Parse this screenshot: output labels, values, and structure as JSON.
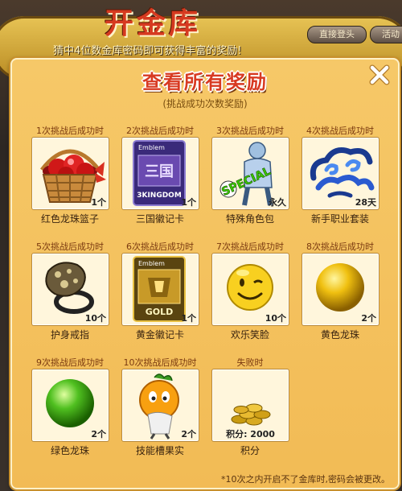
{
  "background": {
    "title": "开金库",
    "subtitle": "猜中4位数金库密码即可获得丰富的奖励!",
    "button_left": "直接登头",
    "button_right": "活动"
  },
  "panel": {
    "title": "查看所有奖励",
    "subtitle": "(挑战成功次数奖励)",
    "close_icon": "close-x-icon",
    "note": "*10次之内开启不了金库时,密码会被更改。"
  },
  "rewards": [
    {
      "condition": "1次挑战后成功时",
      "name": "红色龙珠篮子",
      "qty": "1个",
      "icon": "basket-icon"
    },
    {
      "condition": "2次挑战后成功时",
      "name": "三国徽记卡",
      "qty": "1个",
      "icon": "emblem-card-icon",
      "card_top": "Emblem",
      "card_bottom": "3KINGDOM"
    },
    {
      "condition": "3次挑战后成功时",
      "name": "特殊角色包",
      "qty": "永久",
      "icon": "special-character-icon",
      "badge": "SPECIAL"
    },
    {
      "condition": "4次挑战后成功时",
      "name": "新手职业套装",
      "qty": "28天",
      "icon": "cloud-swirl-icon"
    },
    {
      "condition": "5次挑战后成功时",
      "name": "护身戒指",
      "qty": "10个",
      "icon": "ring-icon"
    },
    {
      "condition": "6次挑战后成功时",
      "name": "黄金徽记卡",
      "qty": "1个",
      "icon": "gold-emblem-card-icon",
      "card_top": "Emblem",
      "card_bottom": "GOLD"
    },
    {
      "condition": "7次挑战后成功时",
      "name": "欢乐笑脸",
      "qty": "10个",
      "icon": "smiley-face-icon"
    },
    {
      "condition": "8次挑战后成功时",
      "name": "黄色龙珠",
      "qty": "2个",
      "icon": "yellow-orb-icon"
    },
    {
      "condition": "9次挑战后成功时",
      "name": "绿色龙珠",
      "qty": "2个",
      "icon": "green-orb-icon"
    },
    {
      "condition": "10次挑战后成功时",
      "name": "技能槽果实",
      "qty": "2个",
      "icon": "fruit-character-icon"
    },
    {
      "condition": "失败时",
      "name": "积分",
      "qty": "积分: 2000",
      "icon": "gold-coins-icon"
    }
  ],
  "colors": {
    "panel": "#f4c25e",
    "title_red": "#d83a22",
    "slot": "#fff6dc"
  }
}
